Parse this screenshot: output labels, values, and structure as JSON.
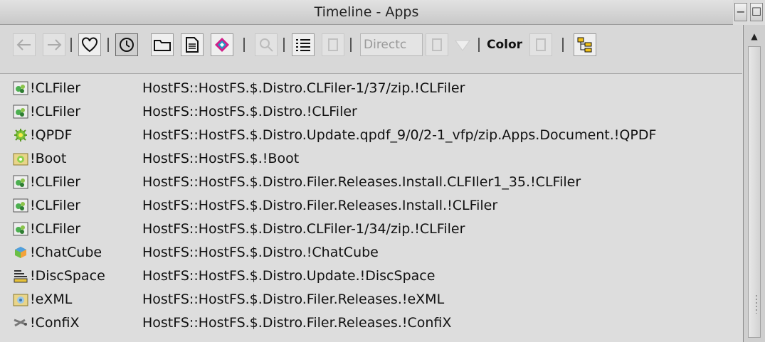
{
  "window": {
    "title": "Timeline - Apps",
    "min_glyph": "−",
    "max_glyph": "☐"
  },
  "toolbar": {
    "back_icon": "back-arrow-icon",
    "forward_icon": "forward-arrow-icon",
    "favourite_icon": "heart-icon",
    "timeline_icon": "clock-icon",
    "folder_icon": "folder-icon",
    "document_icon": "document-icon",
    "app_icon": "app-cube-icon",
    "search_icon": "search-icon",
    "list_view_icon": "list-view-icon",
    "directory_field": "Directc",
    "color_label": "Color",
    "tree_icon": "tree-icon"
  },
  "rows": [
    {
      "icon": "clfiler-icon",
      "name": "!CLFiler",
      "path": "HostFS::HostFS.$.Distro.CLFiler-1/37/zip.!CLFiler"
    },
    {
      "icon": "clfiler-icon",
      "name": "!CLFiler",
      "path": "HostFS::HostFS.$.Distro.!CLFiler"
    },
    {
      "icon": "qpdf-icon",
      "name": "!QPDF",
      "path": "HostFS::HostFS.$.Distro.Update.qpdf_9/0/2-1_vfp/zip.Apps.Document.!QPDF"
    },
    {
      "icon": "boot-icon",
      "name": "!Boot",
      "path": "HostFS::HostFS.$.!Boot"
    },
    {
      "icon": "clfiler-icon",
      "name": "!CLFiler",
      "path": "HostFS::HostFS.$.Distro.Filer.Releases.Install.CLFIler1_35.!CLFiler"
    },
    {
      "icon": "clfiler-icon",
      "name": "!CLFiler",
      "path": "HostFS::HostFS.$.Distro.Filer.Releases.Install.!CLFiler"
    },
    {
      "icon": "clfiler-icon",
      "name": "!CLFiler",
      "path": "HostFS::HostFS.$.Distro.CLFiler-1/34/zip.!CLFiler"
    },
    {
      "icon": "chatcube-icon",
      "name": "!ChatCube",
      "path": "HostFS::HostFS.$.Distro.!ChatCube"
    },
    {
      "icon": "discspace-icon",
      "name": "!DiscSpace",
      "path": "HostFS::HostFS.$.Distro.Update.!DiscSpace"
    },
    {
      "icon": "exml-icon",
      "name": "!eXML",
      "path": "HostFS::HostFS.$.Distro.Filer.Releases.!eXML"
    },
    {
      "icon": "confix-icon",
      "name": "!ConfiX",
      "path": "HostFS::HostFS.$.Distro.Filer.Releases.!ConfiX"
    }
  ],
  "colors": {
    "accent_magenta": "#d0208a",
    "accent_cyan": "#20a0c8",
    "folder_yellow": "#f2c21a"
  }
}
